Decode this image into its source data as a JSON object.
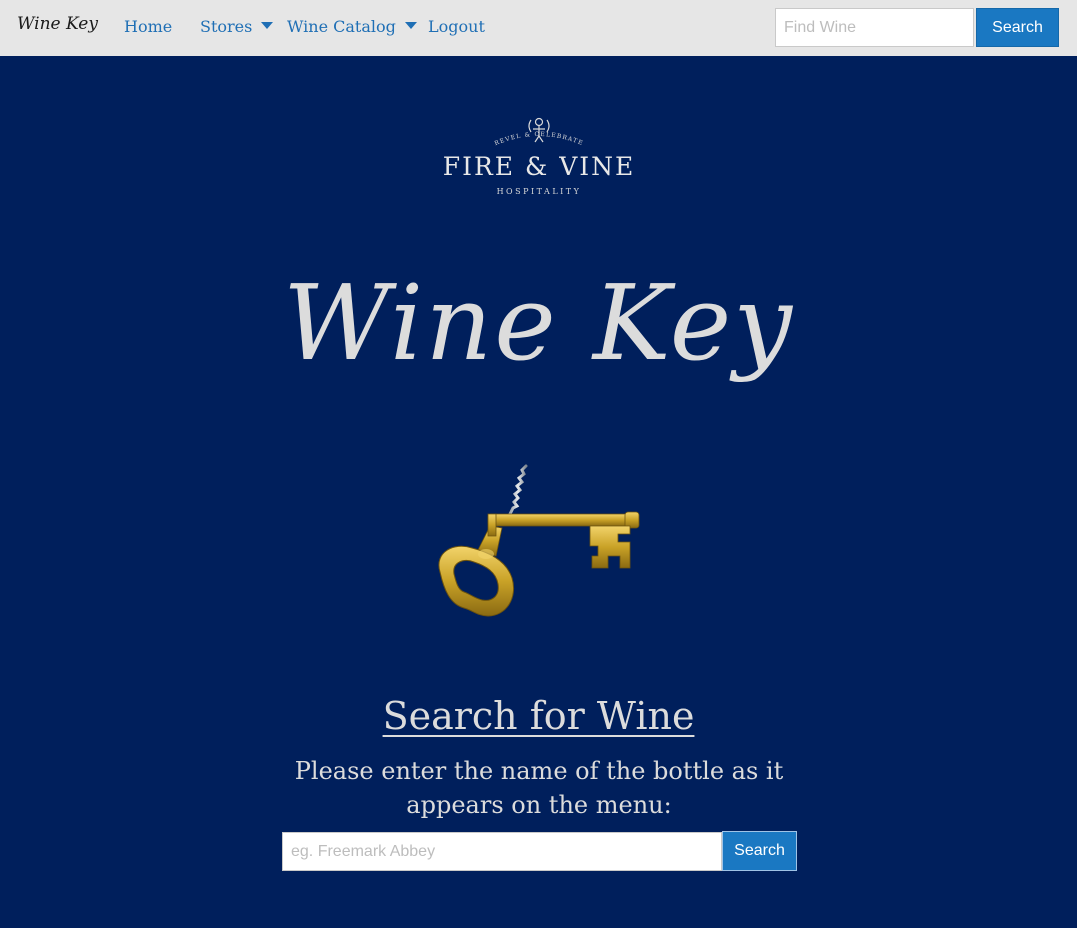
{
  "navbar": {
    "brand": "Wine Key",
    "items": [
      {
        "label": "Home"
      },
      {
        "label": "Stores"
      },
      {
        "label": "Wine Catalog"
      },
      {
        "label": "Logout"
      }
    ],
    "search": {
      "placeholder": "Find Wine",
      "value": "",
      "button_label": "Search"
    }
  },
  "logo": {
    "top_text": "REVEL & CELEBRATE",
    "name": "FIRE & VINE",
    "sub_text": "HOSPITALITY"
  },
  "hero": {
    "title": "Wine Key"
  },
  "search_section": {
    "heading": "Search for Wine",
    "instruction": "Please enter the name of the bottle as it appears on the menu:",
    "placeholder": "eg. Freemark Abbey",
    "value": "",
    "button_label": "Search"
  },
  "colors": {
    "background": "#001f5c",
    "navbar": "#e6e6e6",
    "link": "#1f6fb5",
    "button": "#1a78c2",
    "hero_text": "#dcdcdc",
    "key_gold": "#c9a227"
  },
  "icons": {
    "key": "corkscrew-key-icon",
    "caret": "caret-down-icon"
  }
}
